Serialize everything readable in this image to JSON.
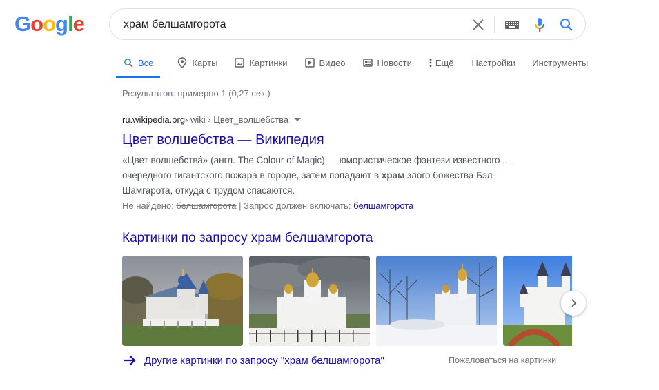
{
  "logo": {
    "letters": [
      "G",
      "o",
      "o",
      "g",
      "l",
      "e"
    ],
    "colors": [
      "#4285F4",
      "#EA4335",
      "#FBBC05",
      "#4285F4",
      "#34A853",
      "#EA4335"
    ]
  },
  "search": {
    "query": "храм белшамгорота"
  },
  "tabs": [
    {
      "label": "Все",
      "icon": "search-icon"
    },
    {
      "label": "Карты",
      "icon": "map-pin-icon"
    },
    {
      "label": "Картинки",
      "icon": "image-icon"
    },
    {
      "label": "Видео",
      "icon": "video-icon"
    },
    {
      "label": "Новости",
      "icon": "news-icon"
    },
    {
      "label": "Ещё",
      "icon": "more-vert-icon"
    },
    {
      "label": "Настройки"
    },
    {
      "label": "Инструменты"
    }
  ],
  "stats": "Результатов: примерно 1 (0,27 сек.)",
  "result": {
    "domain": "ru.wikipedia.org",
    "crumb": " › wiki › Цвет_волшебства",
    "title": "Цвет волшебства — Википедия",
    "snippet_1": "«Цвет волшебства́» (англ. The Colour of Magic) — юмористическое фэнтези известного ...",
    "snippet_2a": "очередного гигантского пожара в городе, затем попадают в ",
    "snippet_bold": "храм",
    "snippet_2b": " злого божества Бэл-",
    "snippet_3": "Шамгарота, откуда с трудом спасаются.",
    "missing_label": "Не найдено: ",
    "missing_term": "белшамгорота",
    "require_label": " | Запрос должен включать: ",
    "require_term": "белшамгорота"
  },
  "images": {
    "heading": "Картинки по запросу храм белшамгорота",
    "more_link": "Другие картинки по запросу \"храм белшамгорота\"",
    "report": "Пожаловаться на картинки"
  },
  "colors": {
    "link": "#1a0dab",
    "accent": "#1a73e8",
    "muted": "#70757a"
  }
}
